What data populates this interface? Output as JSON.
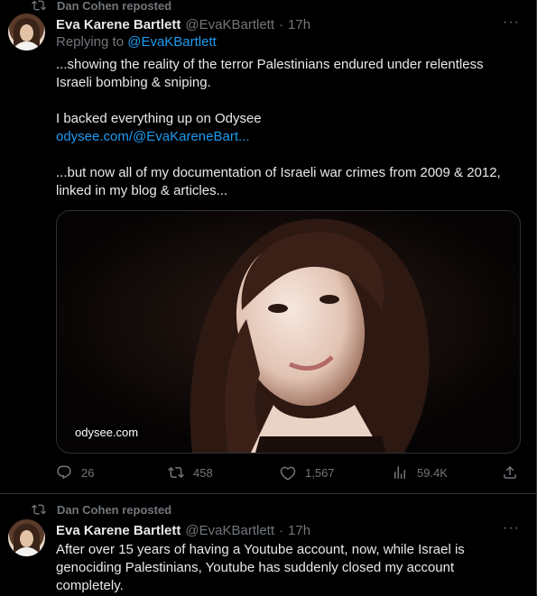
{
  "tweets": [
    {
      "repost_label": "Dan Cohen reposted",
      "author_name": "Eva Karene Bartlett",
      "handle": "@EvaKBartlett",
      "separator": "·",
      "time": "17h",
      "replying_prefix": "Replying to",
      "replying_handle": "@EvaKBartlett",
      "text_lines": [
        "...showing the reality of the terror Palestinians endured under relentless",
        "Israeli bombing & sniping.",
        "I backed everything up on Odysee",
        "...but now all of my documentation of Israeli war crimes from 2009 & 2012,",
        "linked in my blog & articles..."
      ],
      "link_text": "odysee.com/@EvaKareneBart...",
      "card_domain": "odysee.com",
      "replies": "26",
      "reposts": "458",
      "likes": "1,567",
      "views": "59.4K"
    },
    {
      "repost_label": "Dan Cohen reposted",
      "author_name": "Eva Karene Bartlett",
      "handle": "@EvaKBartlett",
      "separator": "·",
      "time": "17h",
      "text_lines": [
        "After over 15 years of having a Youtube account, now, while Israel is",
        "genociding Palestinians, Youtube has suddenly closed my account",
        "completely."
      ]
    }
  ],
  "icons": {
    "repost": "repost-icon",
    "more": "more-icon",
    "reply": "reply-icon",
    "like": "heart-icon",
    "views": "analytics-icon",
    "share": "share-icon"
  },
  "colors": {
    "background": "#000000",
    "text": "#e7e9ea",
    "muted": "#71767b",
    "link": "#1d9bf0",
    "border": "#2f3336"
  }
}
